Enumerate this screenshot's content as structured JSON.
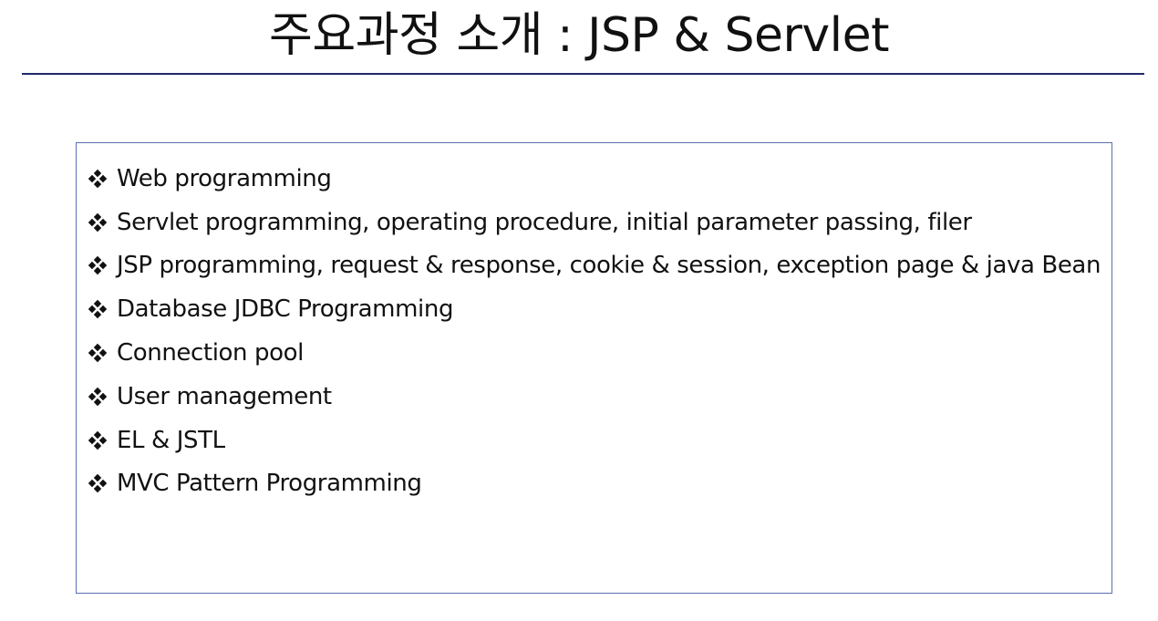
{
  "slide": {
    "title": "주요과정 소개 : JSP & Servlet"
  },
  "topics": [
    {
      "label": "Web programming",
      "icon": "diamond-bullet-icon"
    },
    {
      "label": "Servlet programming, operating procedure, initial parameter passing, filer",
      "icon": "diamond-bullet-icon"
    },
    {
      "label": "JSP programming, request & response, cookie & session, exception page & java Bean",
      "icon": "diamond-bullet-icon"
    },
    {
      "label": "Database JDBC Programming",
      "icon": "diamond-bullet-icon"
    },
    {
      "label": "Connection pool",
      "icon": "diamond-bullet-icon"
    },
    {
      "label": "User management",
      "icon": "diamond-bullet-icon"
    },
    {
      "label": "EL & JSTL",
      "icon": "diamond-bullet-icon"
    },
    {
      "label": "MVC Pattern Programming",
      "icon": "diamond-bullet-icon"
    }
  ],
  "colors": {
    "title_rule": "#1f2a6b",
    "box_border": "#5a6fb0",
    "text": "#111111"
  }
}
